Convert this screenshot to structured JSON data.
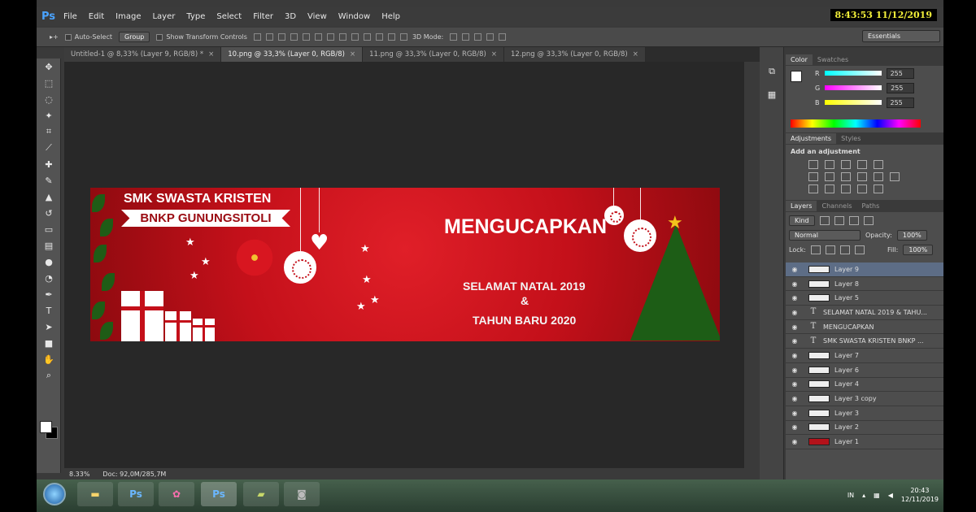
{
  "app": {
    "logo": "Ps",
    "menu": [
      "File",
      "Edit",
      "Image",
      "Layer",
      "Type",
      "Select",
      "Filter",
      "3D",
      "View",
      "Window",
      "Help"
    ],
    "clock_overlay": "8:43:53  11/12/2019"
  },
  "options": {
    "auto_select": "Auto-Select",
    "group": "Group",
    "transform": "Show Transform Controls",
    "mode3d": "3D Mode:",
    "workspace": "Essentials"
  },
  "tabs": [
    {
      "label": "Untitled-1 @ 8,33% (Layer 9, RGB/8) *",
      "close": "×"
    },
    {
      "label": "10.png @ 33,3% (Layer 0, RGB/8)",
      "close": "×"
    },
    {
      "label": "11.png @ 33,3% (Layer 0, RGB/8)",
      "close": "×"
    },
    {
      "label": "12.png @ 33,3% (Layer 0, RGB/8)",
      "close": "×"
    }
  ],
  "banner": {
    "line1": "SMK SWASTA KRISTEN",
    "line2": "BNKP GUNUNGSITOLI",
    "headline": "MENGUCAPKAN",
    "greeting1": "SELAMAT NATAL 2019",
    "amp": "&",
    "greeting2": "TAHUN BARU 2020"
  },
  "status": {
    "zoom": "8.33%",
    "doc": "Doc: 92,0M/285,7M"
  },
  "panels": {
    "color_tabs": [
      "Color",
      "Swatches"
    ],
    "rgb": [
      {
        "ch": "R",
        "val": "255"
      },
      {
        "ch": "G",
        "val": "255"
      },
      {
        "ch": "B",
        "val": "255"
      }
    ],
    "adj_tabs": [
      "Adjustments",
      "Styles"
    ],
    "adj_title": "Add an adjustment",
    "layer_tabs": [
      "Layers",
      "Channels",
      "Paths"
    ],
    "kind": "Kind",
    "blend": "Normal",
    "opacity_label": "Opacity:",
    "opacity": "100%",
    "lock_label": "Lock:",
    "fill_label": "Fill:",
    "fill": "100%",
    "layers": [
      {
        "name": "Layer 9",
        "type": "img"
      },
      {
        "name": "Layer 8",
        "type": "img"
      },
      {
        "name": "Layer 5",
        "type": "img"
      },
      {
        "name": "SELAMAT NATAL 2019 & TAHU...",
        "type": "text"
      },
      {
        "name": "MENGUCAPKAN",
        "type": "text"
      },
      {
        "name": "SMK SWASTA KRISTEN  BNKP ...",
        "type": "text"
      },
      {
        "name": "Layer 7",
        "type": "img"
      },
      {
        "name": "Layer 6",
        "type": "img"
      },
      {
        "name": "Layer 4",
        "type": "img"
      },
      {
        "name": "Layer 3 copy",
        "type": "img"
      },
      {
        "name": "Layer 3",
        "type": "img"
      },
      {
        "name": "Layer 2",
        "type": "img"
      },
      {
        "name": "Layer 1",
        "type": "red"
      }
    ]
  },
  "taskbar": {
    "ps1": "Ps",
    "ps2": "Ps",
    "lang": "IN",
    "time": "20:43",
    "date": "12/11/2019"
  }
}
